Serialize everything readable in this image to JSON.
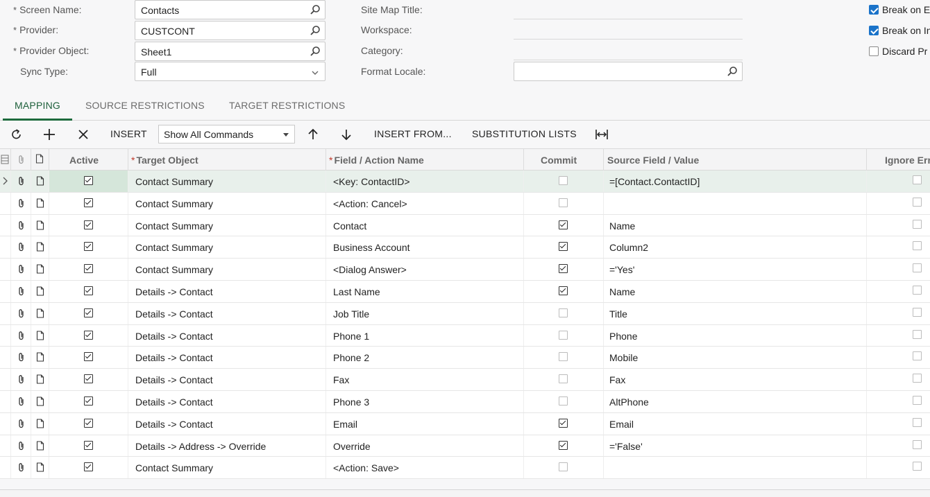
{
  "form": {
    "screen_name": {
      "label": "Screen Name:",
      "value": "Contacts"
    },
    "provider": {
      "label": "Provider:",
      "value": "CUSTCONT"
    },
    "provider_object": {
      "label": "Provider Object:",
      "value": "Sheet1"
    },
    "sync_type": {
      "label": "Sync Type:",
      "value": "Full"
    },
    "site_map_title": {
      "label": "Site Map Title:",
      "value": ""
    },
    "workspace": {
      "label": "Workspace:",
      "value": ""
    },
    "category": {
      "label": "Category:",
      "value": ""
    },
    "format_locale": {
      "label": "Format Locale:",
      "value": ""
    },
    "required_mark": "*",
    "checkboxes": [
      {
        "label": "Break on E",
        "checked": true
      },
      {
        "label": "Break on In",
        "checked": true
      },
      {
        "label": "Discard Pr",
        "checked": false
      }
    ]
  },
  "tabs": [
    {
      "label": "MAPPING",
      "active": true
    },
    {
      "label": "SOURCE RESTRICTIONS",
      "active": false
    },
    {
      "label": "TARGET RESTRICTIONS",
      "active": false
    }
  ],
  "toolbar": {
    "insert_label": "INSERT",
    "command_filter": "Show All Commands",
    "insert_from_label": "INSERT FROM...",
    "substitution_lists_label": "SUBSTITUTION LISTS",
    "icons": [
      "refresh-icon",
      "add-icon",
      "delete-icon",
      "move-up-icon",
      "move-down-icon",
      "fit-columns-icon"
    ]
  },
  "grid": {
    "headers": {
      "active": "Active",
      "target_object": "Target Object",
      "field_action": "Field / Action Name",
      "commit": "Commit",
      "source_field": "Source Field / Value",
      "ignore_errors": "Ignore Erro"
    },
    "rows": [
      {
        "active": true,
        "target": "Contact Summary",
        "field": "<Key: ContactID>",
        "commit": false,
        "source": "=[Contact.ContactID]",
        "ignore": false,
        "selected": true
      },
      {
        "active": true,
        "target": "Contact Summary",
        "field": "<Action: Cancel>",
        "commit": false,
        "source": "",
        "ignore": false
      },
      {
        "active": true,
        "target": "Contact Summary",
        "field": "Contact",
        "commit": true,
        "source": "Name",
        "ignore": false
      },
      {
        "active": true,
        "target": "Contact Summary",
        "field": "Business Account",
        "commit": true,
        "source": "Column2",
        "ignore": false
      },
      {
        "active": true,
        "target": "Contact Summary",
        "field": "<Dialog Answer>",
        "commit": true,
        "source": "='Yes'",
        "ignore": false
      },
      {
        "active": true,
        "target": "Details -> Contact",
        "field": "Last Name",
        "commit": true,
        "source": "Name",
        "ignore": false
      },
      {
        "active": true,
        "target": "Details -> Contact",
        "field": "Job Title",
        "commit": false,
        "source": "Title",
        "ignore": false
      },
      {
        "active": true,
        "target": "Details -> Contact",
        "field": "Phone 1",
        "commit": false,
        "source": "Phone",
        "ignore": false
      },
      {
        "active": true,
        "target": "Details -> Contact",
        "field": "Phone 2",
        "commit": false,
        "source": "Mobile",
        "ignore": false
      },
      {
        "active": true,
        "target": "Details -> Contact",
        "field": "Fax",
        "commit": false,
        "source": "Fax",
        "ignore": false
      },
      {
        "active": true,
        "target": "Details -> Contact",
        "field": "Phone 3",
        "commit": false,
        "source": "AltPhone",
        "ignore": false
      },
      {
        "active": true,
        "target": "Details -> Contact",
        "field": "Email",
        "commit": true,
        "source": "Email",
        "ignore": false
      },
      {
        "active": true,
        "target": "Details -> Address -> Override",
        "field": "Override",
        "commit": true,
        "source": "='False'",
        "ignore": false
      },
      {
        "active": true,
        "target": "Contact Summary",
        "field": "<Action: Save>",
        "commit": false,
        "source": "",
        "ignore": false
      }
    ]
  },
  "colors": {
    "accent_green": "#1d6b3d",
    "checkbox_blue": "#1a73c9",
    "required_star": "#c0392b",
    "selected_row": "#e8f0eb"
  }
}
